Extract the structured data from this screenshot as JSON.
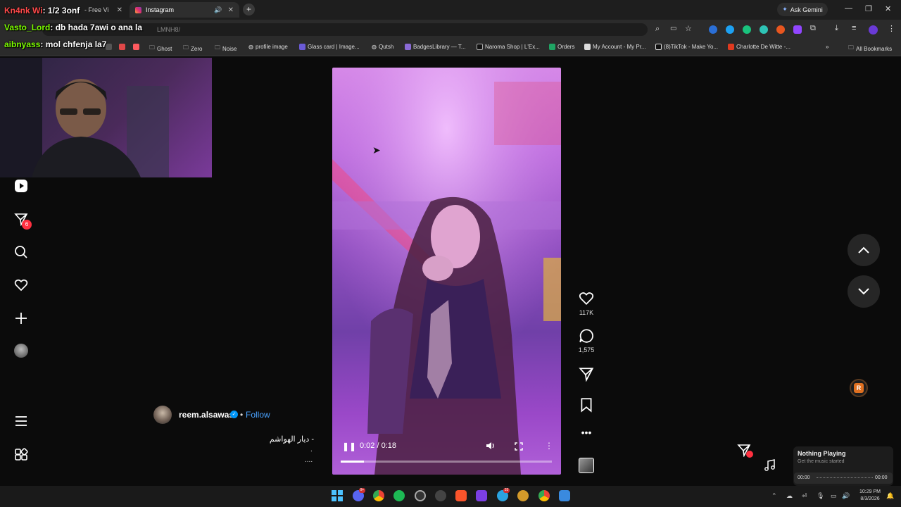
{
  "browser": {
    "tabs": [
      {
        "label": "- Free Vi",
        "active": false
      },
      {
        "label": "Instagram",
        "active": true
      }
    ],
    "new_tab": "+",
    "ask_gemini": "Ask Gemini",
    "url": "LMNH8/",
    "bookmarks": [
      {
        "label": "Ghost",
        "icon": "folder-icon"
      },
      {
        "label": "Zero",
        "icon": "folder-icon"
      },
      {
        "label": "Noise",
        "icon": "folder-icon"
      },
      {
        "label": "profile image",
        "icon": "globe-icon"
      },
      {
        "label": "Glass card | Image...",
        "icon": "site-icon"
      },
      {
        "label": "Qutsh",
        "icon": "globe-icon"
      },
      {
        "label": "BadgesLibrary — T...",
        "icon": "site-icon"
      },
      {
        "label": "Naroma Shop | L'Ex...",
        "icon": "site-icon"
      },
      {
        "label": "Orders",
        "icon": "site-icon"
      },
      {
        "label": "My Account - My Pr...",
        "icon": "site-icon"
      },
      {
        "label": "(8)TikTok - Make Yo...",
        "icon": "tiktok-icon"
      },
      {
        "label": "Charlotte De Witte -...",
        "icon": "site-icon"
      }
    ],
    "all_bookmarks": "All Bookmarks"
  },
  "chat_overlay": [
    {
      "user": "Kn4nk Wi",
      "message": ": 1/2 3onf"
    },
    {
      "user": "Vasto_Lord",
      "message": ": db hada 7awi o ana la"
    },
    {
      "user": "aibnyass",
      "message": ": mol chfenja la7"
    }
  ],
  "nav": {
    "notifications_count": "6"
  },
  "video": {
    "time": "0:02 / 0:18",
    "progress": 0.11
  },
  "actions": {
    "likes": "117K",
    "comments": "1,575"
  },
  "author": {
    "username": "reem.alsawas",
    "separator": "•",
    "follow_label": "Follow",
    "caption": "- ديار الهواشم",
    "caption_line2": ".",
    "more": "...."
  },
  "music_widget": {
    "title": "Nothing Playing",
    "subtitle": "Get the music started",
    "time_start": "00:00",
    "time_end": "00:00"
  },
  "taskbar": {
    "time": "10:29 PM",
    "date": "8/3/2026",
    "badges": [
      "9+",
      "33"
    ]
  },
  "colors": {
    "accent_blue": "#4aa3ff",
    "badge_red": "#ff3040",
    "video_magenta": "#c070e0"
  }
}
